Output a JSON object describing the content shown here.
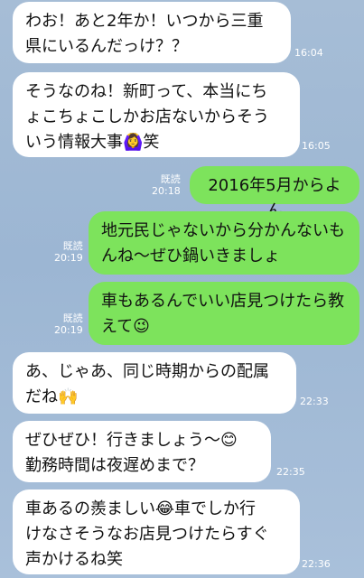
{
  "messages": [
    {
      "side": "in",
      "text": "わお！あと2年か！いつから三重\n県にいるんだっけ？？",
      "time": "16:04"
    },
    {
      "side": "in",
      "text": "そうなのね！新町って、本当にち\nょこちょこしかお店ないからそう\nいう情報大事🙆‍♀️笑",
      "time": "16:05"
    },
    {
      "side": "out",
      "text": "2016年5月からよん",
      "read": "既読",
      "time": "20:18"
    },
    {
      "side": "out",
      "text": "地元民じゃないから分かんないも\nんね〜ぜひ鍋いきましょ",
      "read": "既読",
      "time": "20:19"
    },
    {
      "side": "out",
      "text": "車もあるんでいい店見つけたら教\nえて😉",
      "read": "既読",
      "time": "20:19"
    },
    {
      "side": "in",
      "text": "あ、じゃあ、同じ時期からの配属\nだね🙌",
      "time": "22:33"
    },
    {
      "side": "in",
      "text": "ぜひぜひ！行きましょう〜😊\n勤務時間は夜遅めまで？",
      "time": "22:35"
    },
    {
      "side": "in",
      "text": "車あるの羨ましい😂車でしか行\nけなさそうなお店見つけたらすぐ\n声かけるね笑",
      "time": "22:36"
    }
  ]
}
